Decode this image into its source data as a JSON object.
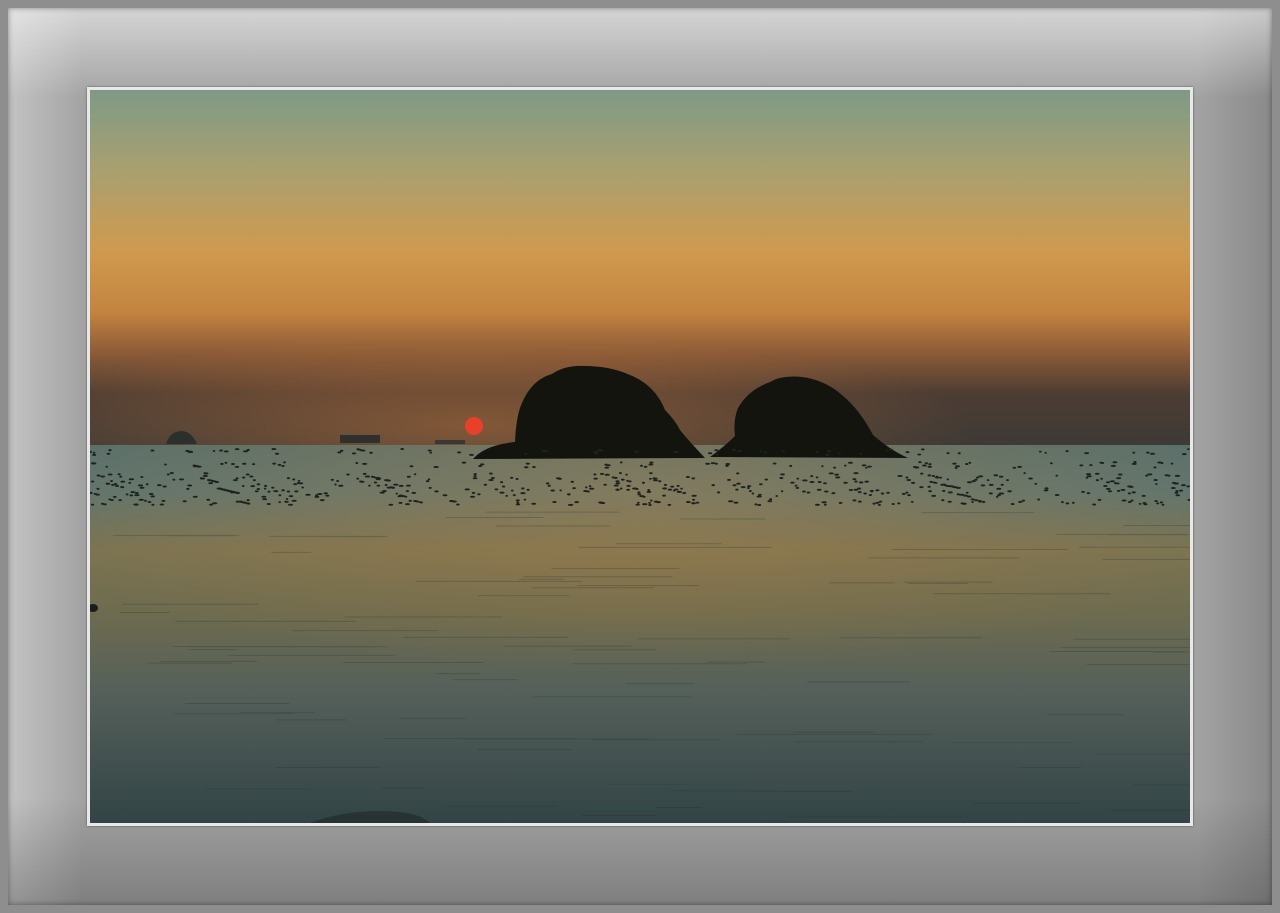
{
  "scene": {
    "subject": "sunset-over-sea-with-two-islands",
    "colors": {
      "sky_top": "#7f9b84",
      "sky_mid": "#d49a4b",
      "sky_horizon": "#4a3e33",
      "sun": "#e8402a",
      "island": "#14140f",
      "sea_far": "#4e6a67",
      "sea_mid": "#6b6a4c",
      "sea_near": "#3b4a4a",
      "frame": "#a3a3a3",
      "mat": "#e8e8e8"
    }
  }
}
